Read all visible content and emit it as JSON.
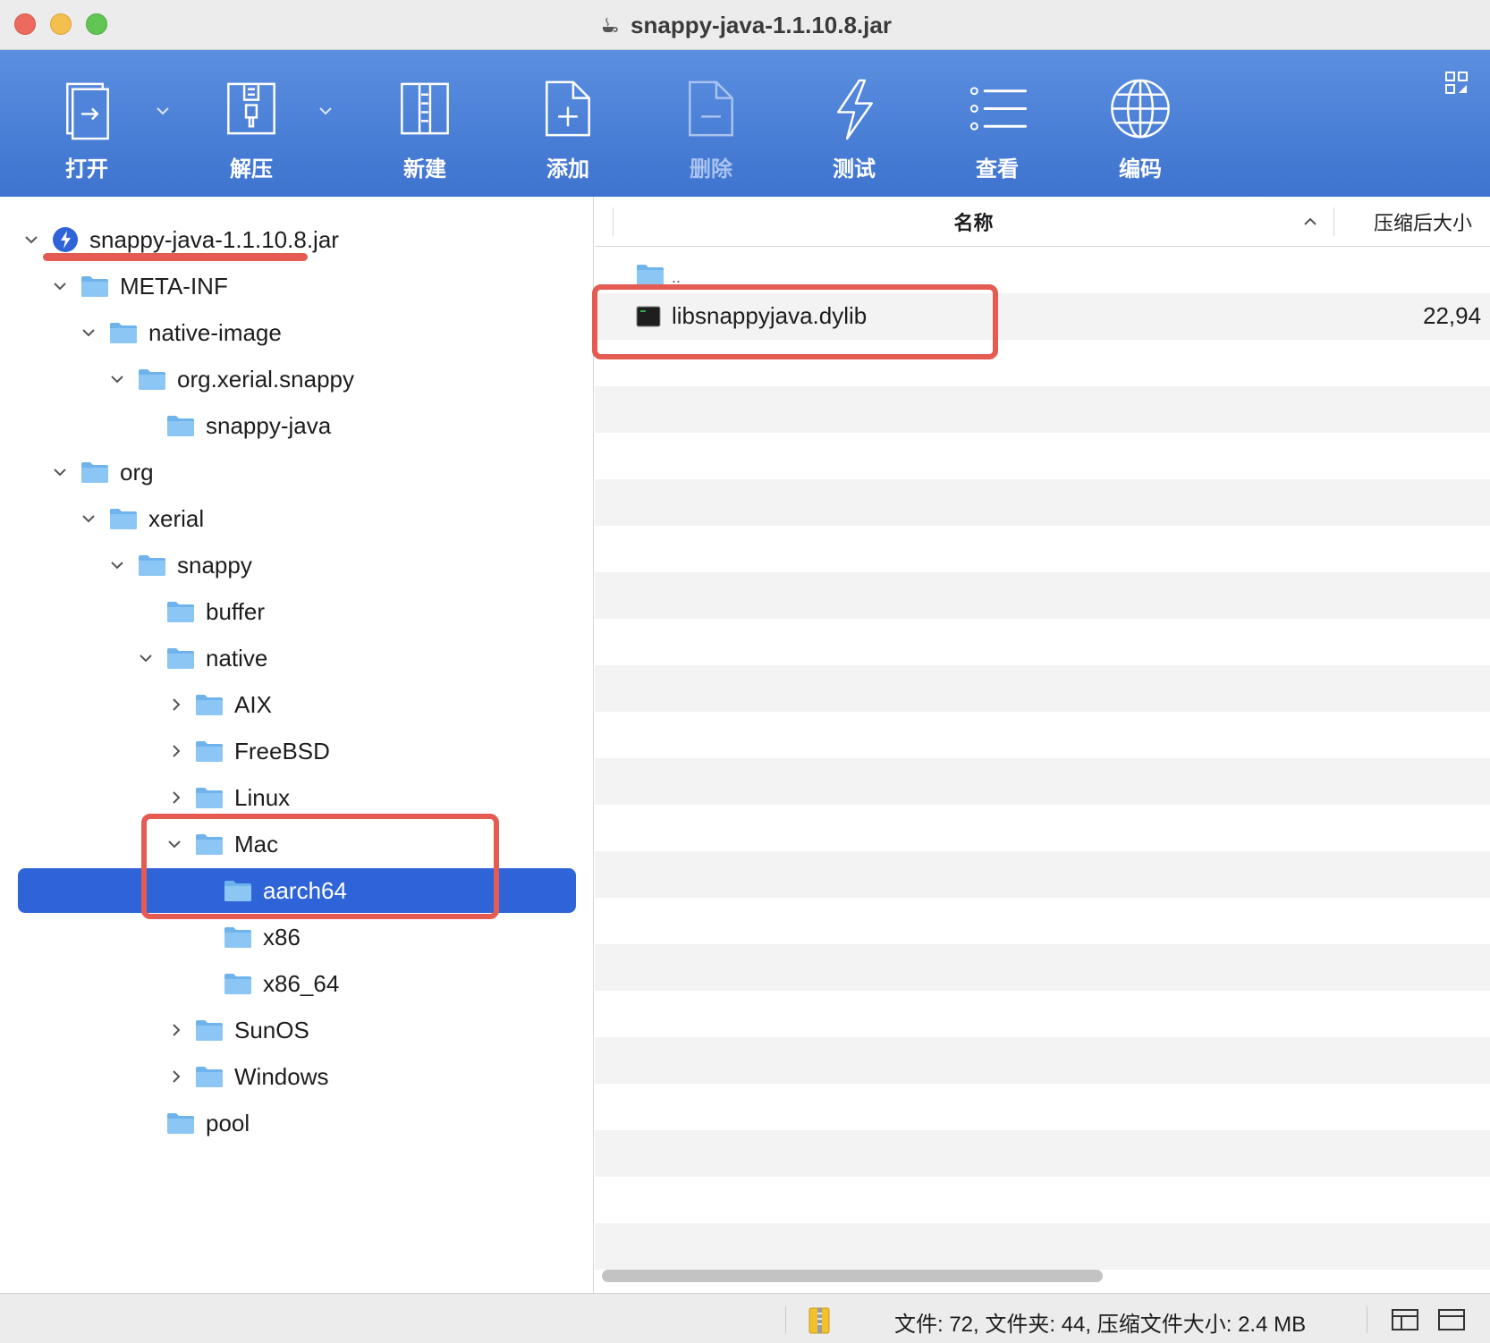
{
  "window": {
    "title": "snappy-java-1.1.10.8.jar",
    "title_icon": "java-cup-icon"
  },
  "toolbar": {
    "items": [
      {
        "label": "打开",
        "icon": "open-icon",
        "enabled": true,
        "has_menu": true
      },
      {
        "label": "解压",
        "icon": "extract-icon",
        "enabled": true,
        "has_menu": true
      },
      {
        "label": "新建",
        "icon": "new-archive-icon",
        "enabled": true,
        "has_menu": false
      },
      {
        "label": "添加",
        "icon": "add-icon",
        "enabled": true,
        "has_menu": false
      },
      {
        "label": "删除",
        "icon": "delete-icon",
        "enabled": false,
        "has_menu": false
      },
      {
        "label": "测试",
        "icon": "test-icon",
        "enabled": true,
        "has_menu": false
      },
      {
        "label": "查看",
        "icon": "view-list-icon",
        "enabled": true,
        "has_menu": false
      },
      {
        "label": "编码",
        "icon": "globe-icon",
        "enabled": true,
        "has_menu": false
      }
    ],
    "right_icon": "grid-icon"
  },
  "sidebar": {
    "tree": [
      {
        "label": "snappy-java-1.1.10.8.jar",
        "depth": 0,
        "expanded": true,
        "icon": "archive-icon"
      },
      {
        "label": "META-INF",
        "depth": 1,
        "expanded": true,
        "icon": "folder-icon"
      },
      {
        "label": "native-image",
        "depth": 2,
        "expanded": true,
        "icon": "folder-icon"
      },
      {
        "label": "org.xerial.snappy",
        "depth": 3,
        "expanded": true,
        "icon": "folder-icon"
      },
      {
        "label": "snappy-java",
        "depth": 4,
        "icon": "folder-icon"
      },
      {
        "label": "org",
        "depth": 1,
        "expanded": true,
        "icon": "folder-icon"
      },
      {
        "label": "xerial",
        "depth": 2,
        "expanded": true,
        "icon": "folder-icon"
      },
      {
        "label": "snappy",
        "depth": 3,
        "expanded": true,
        "icon": "folder-icon"
      },
      {
        "label": "buffer",
        "depth": 4,
        "icon": "folder-icon"
      },
      {
        "label": "native",
        "depth": 4,
        "expanded": true,
        "icon": "folder-icon"
      },
      {
        "label": "AIX",
        "depth": 5,
        "expanded": false,
        "icon": "folder-icon"
      },
      {
        "label": "FreeBSD",
        "depth": 5,
        "expanded": false,
        "icon": "folder-icon"
      },
      {
        "label": "Linux",
        "depth": 5,
        "expanded": false,
        "icon": "folder-icon"
      },
      {
        "label": "Mac",
        "depth": 5,
        "expanded": true,
        "icon": "folder-icon"
      },
      {
        "label": "aarch64",
        "depth": 6,
        "selected": true,
        "icon": "folder-icon"
      },
      {
        "label": "x86",
        "depth": 6,
        "icon": "folder-icon"
      },
      {
        "label": "x86_64",
        "depth": 6,
        "icon": "folder-icon"
      },
      {
        "label": "SunOS",
        "depth": 5,
        "expanded": false,
        "icon": "folder-icon"
      },
      {
        "label": "Windows",
        "depth": 5,
        "expanded": false,
        "icon": "folder-icon"
      },
      {
        "label": "pool",
        "depth": 4,
        "icon": "folder-icon"
      }
    ]
  },
  "file_list": {
    "columns": [
      {
        "label": "名称",
        "sorted": "ascending"
      },
      {
        "label": "压缩后大小"
      }
    ],
    "rows": [
      {
        "name": "..",
        "size": "",
        "icon": "folder-icon"
      },
      {
        "name": "libsnappyjava.dylib",
        "size": "22,94",
        "icon": "terminal-executable-icon"
      }
    ]
  },
  "status": {
    "text": "文件: 72, 文件夹: 44, 压缩文件大小: 2.4 MB",
    "archive_icon": "archive-zip-icon",
    "view_icons": [
      "split-view-icon",
      "single-view-icon"
    ]
  },
  "colors": {
    "toolbar_top": "#5b8fe0",
    "toolbar_bottom": "#3e73cf",
    "selection": "#2f64d8",
    "folder": "#6fb3ec",
    "annotation": "#e45b52"
  }
}
